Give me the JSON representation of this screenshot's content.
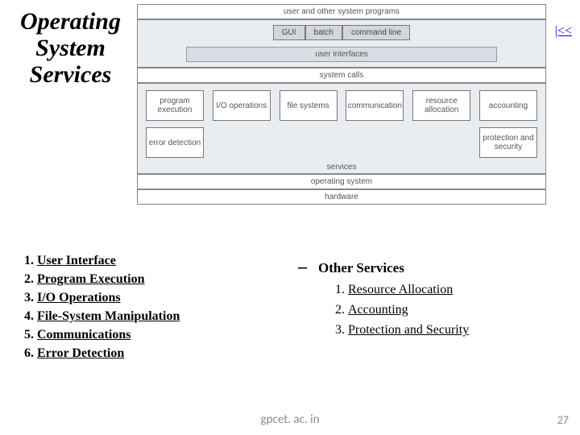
{
  "title_l1": "Operating",
  "title_l2": "System",
  "title_l3": "Services",
  "back_link": "|<<",
  "diagram": {
    "top_band": "user and other system programs",
    "gui": [
      "GUI",
      "batch",
      "command line"
    ],
    "ui_band": "user interfaces",
    "syscalls": "system calls",
    "services_row1": [
      "program execution",
      "I/O operations",
      "file systems",
      "communication",
      "resource allocation",
      "accounting"
    ],
    "services_row2_left": "error detection",
    "services_row2_right": "protection and security",
    "services_caption": "services",
    "os_band": "operating system",
    "hw_band": "hardware"
  },
  "left_list": [
    "User Interface",
    "Program Execution",
    "I/O Operations",
    "File-System Manipulation",
    "Communications",
    "Error Detection"
  ],
  "right_header": "Other Services",
  "right_list": [
    "Resource Allocation",
    "Accounting",
    "Protection and Security"
  ],
  "footer_site": "gpcet. ac. in",
  "footer_num": "27"
}
